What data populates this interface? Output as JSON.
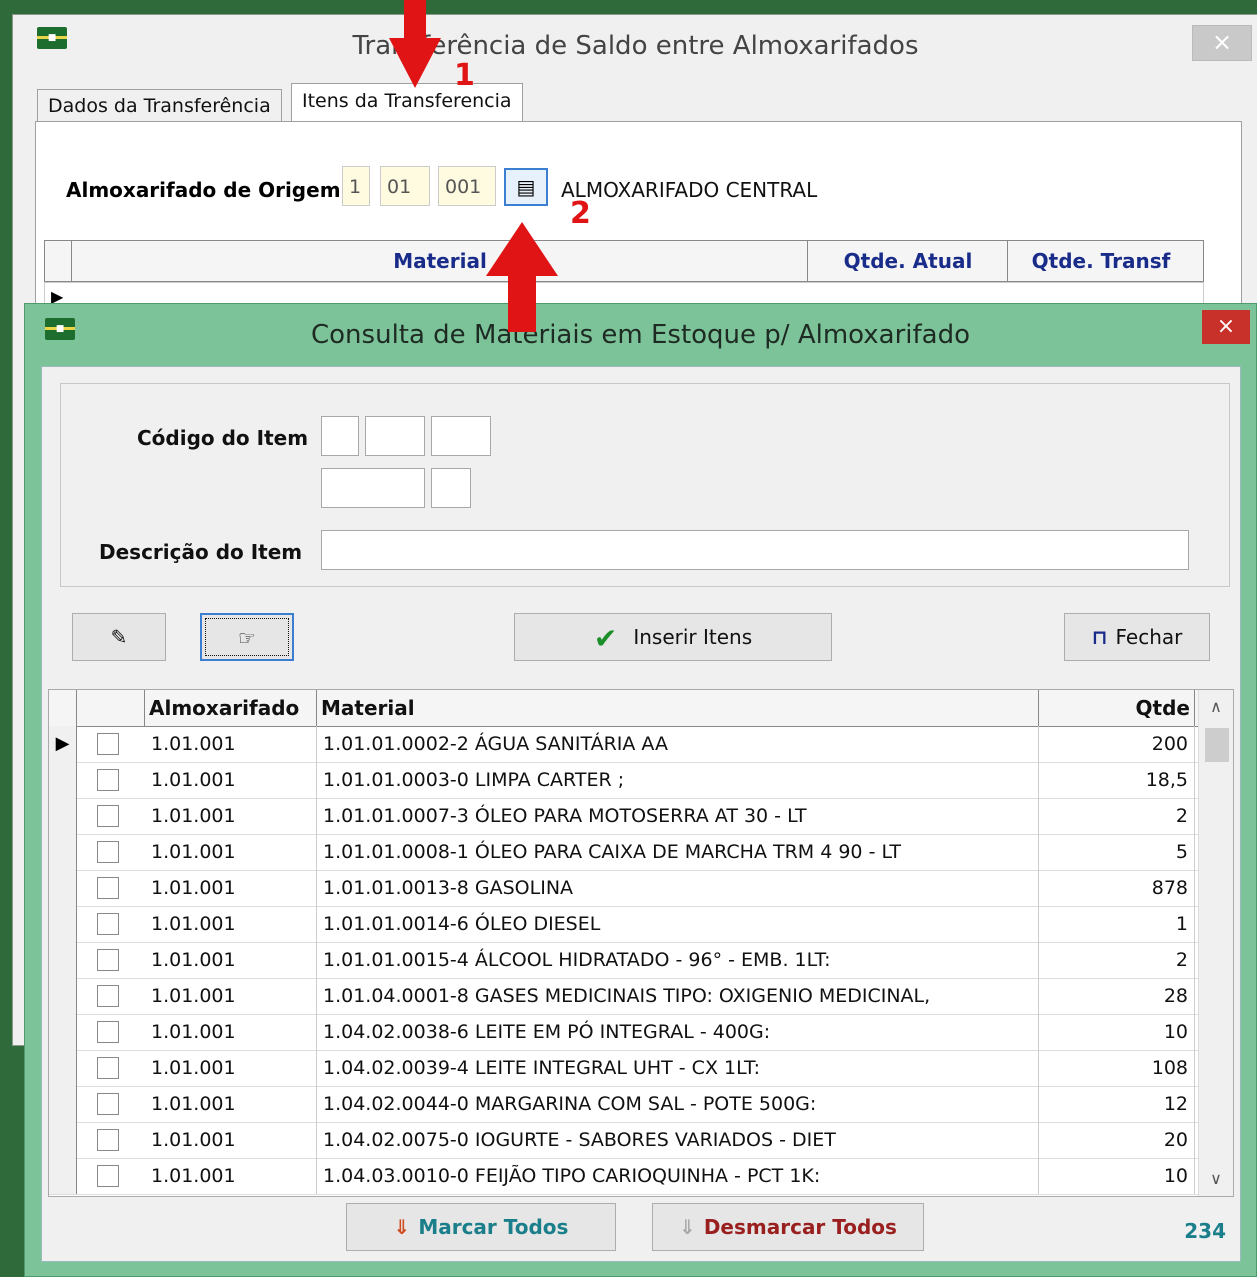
{
  "back_window": {
    "title": "Transferência de Saldo entre Almoxarifados",
    "close_label": "×",
    "tabs": [
      {
        "label": "Dados da Transferência"
      },
      {
        "label": "Itens da Transferencia"
      }
    ],
    "origem": {
      "label": "Almoxarifado de Origem",
      "code_parts": [
        "1",
        "01",
        "001"
      ],
      "name": "ALMOXARIFADO CENTRAL"
    },
    "grid_headers": [
      "Material",
      "Qtde. Atual",
      "Qtde. Transf"
    ]
  },
  "annotations": [
    "1",
    "2"
  ],
  "dialog": {
    "title": "Consulta de Materiais em Estoque p/ Almoxarifado",
    "close_label": "×",
    "filters": {
      "codigo_label": "Código do Item",
      "descricao_label": "Descrição do Item",
      "descricao_value": ""
    },
    "toolbar": {
      "inserir_label": "Inserir Itens",
      "fechar_label": "Fechar"
    },
    "grid": {
      "headers": [
        "Almoxarifado",
        "Material",
        "Qtde"
      ],
      "rows": [
        {
          "almox": "1.01.001",
          "material": "1.01.01.0002-2 ÁGUA SANITÁRIA AA",
          "qtde": "200"
        },
        {
          "almox": "1.01.001",
          "material": "1.01.01.0003-0 LIMPA CARTER ;",
          "qtde": "18,5"
        },
        {
          "almox": "1.01.001",
          "material": "1.01.01.0007-3 ÓLEO PARA MOTOSERRA AT 30 - LT",
          "qtde": "2"
        },
        {
          "almox": "1.01.001",
          "material": "1.01.01.0008-1 ÓLEO PARA CAIXA DE MARCHA TRM 4 90 - LT",
          "qtde": "5"
        },
        {
          "almox": "1.01.001",
          "material": "1.01.01.0013-8 GASOLINA",
          "qtde": "878"
        },
        {
          "almox": "1.01.001",
          "material": "1.01.01.0014-6 ÓLEO DIESEL",
          "qtde": "1"
        },
        {
          "almox": "1.01.001",
          "material": "1.01.01.0015-4 ÁLCOOL HIDRATADO - 96° - EMB. 1LT:",
          "qtde": "2"
        },
        {
          "almox": "1.01.001",
          "material": "1.01.04.0001-8 GASES MEDICINAIS TIPO: OXIGENIO MEDICINAL,",
          "qtde": "28"
        },
        {
          "almox": "1.01.001",
          "material": "1.04.02.0038-6 LEITE EM PÓ INTEGRAL - 400G:",
          "qtde": "10"
        },
        {
          "almox": "1.01.001",
          "material": "1.04.02.0039-4 LEITE INTEGRAL UHT - CX 1LT:",
          "qtde": "108"
        },
        {
          "almox": "1.01.001",
          "material": "1.04.02.0044-0 MARGARINA COM SAL - POTE 500G:",
          "qtde": "12"
        },
        {
          "almox": "1.01.001",
          "material": "1.04.02.0075-0 IOGURTE - SABORES VARIADOS - DIET",
          "qtde": "20"
        },
        {
          "almox": "1.01.001",
          "material": "1.04.03.0010-0 FEIJÃO TIPO CARIOQUINHA - PCT 1K:",
          "qtde": "10"
        }
      ]
    },
    "footer": {
      "marcar_label": "Marcar Todos",
      "desmarcar_label": "Desmarcar Todos",
      "count": "234"
    }
  }
}
